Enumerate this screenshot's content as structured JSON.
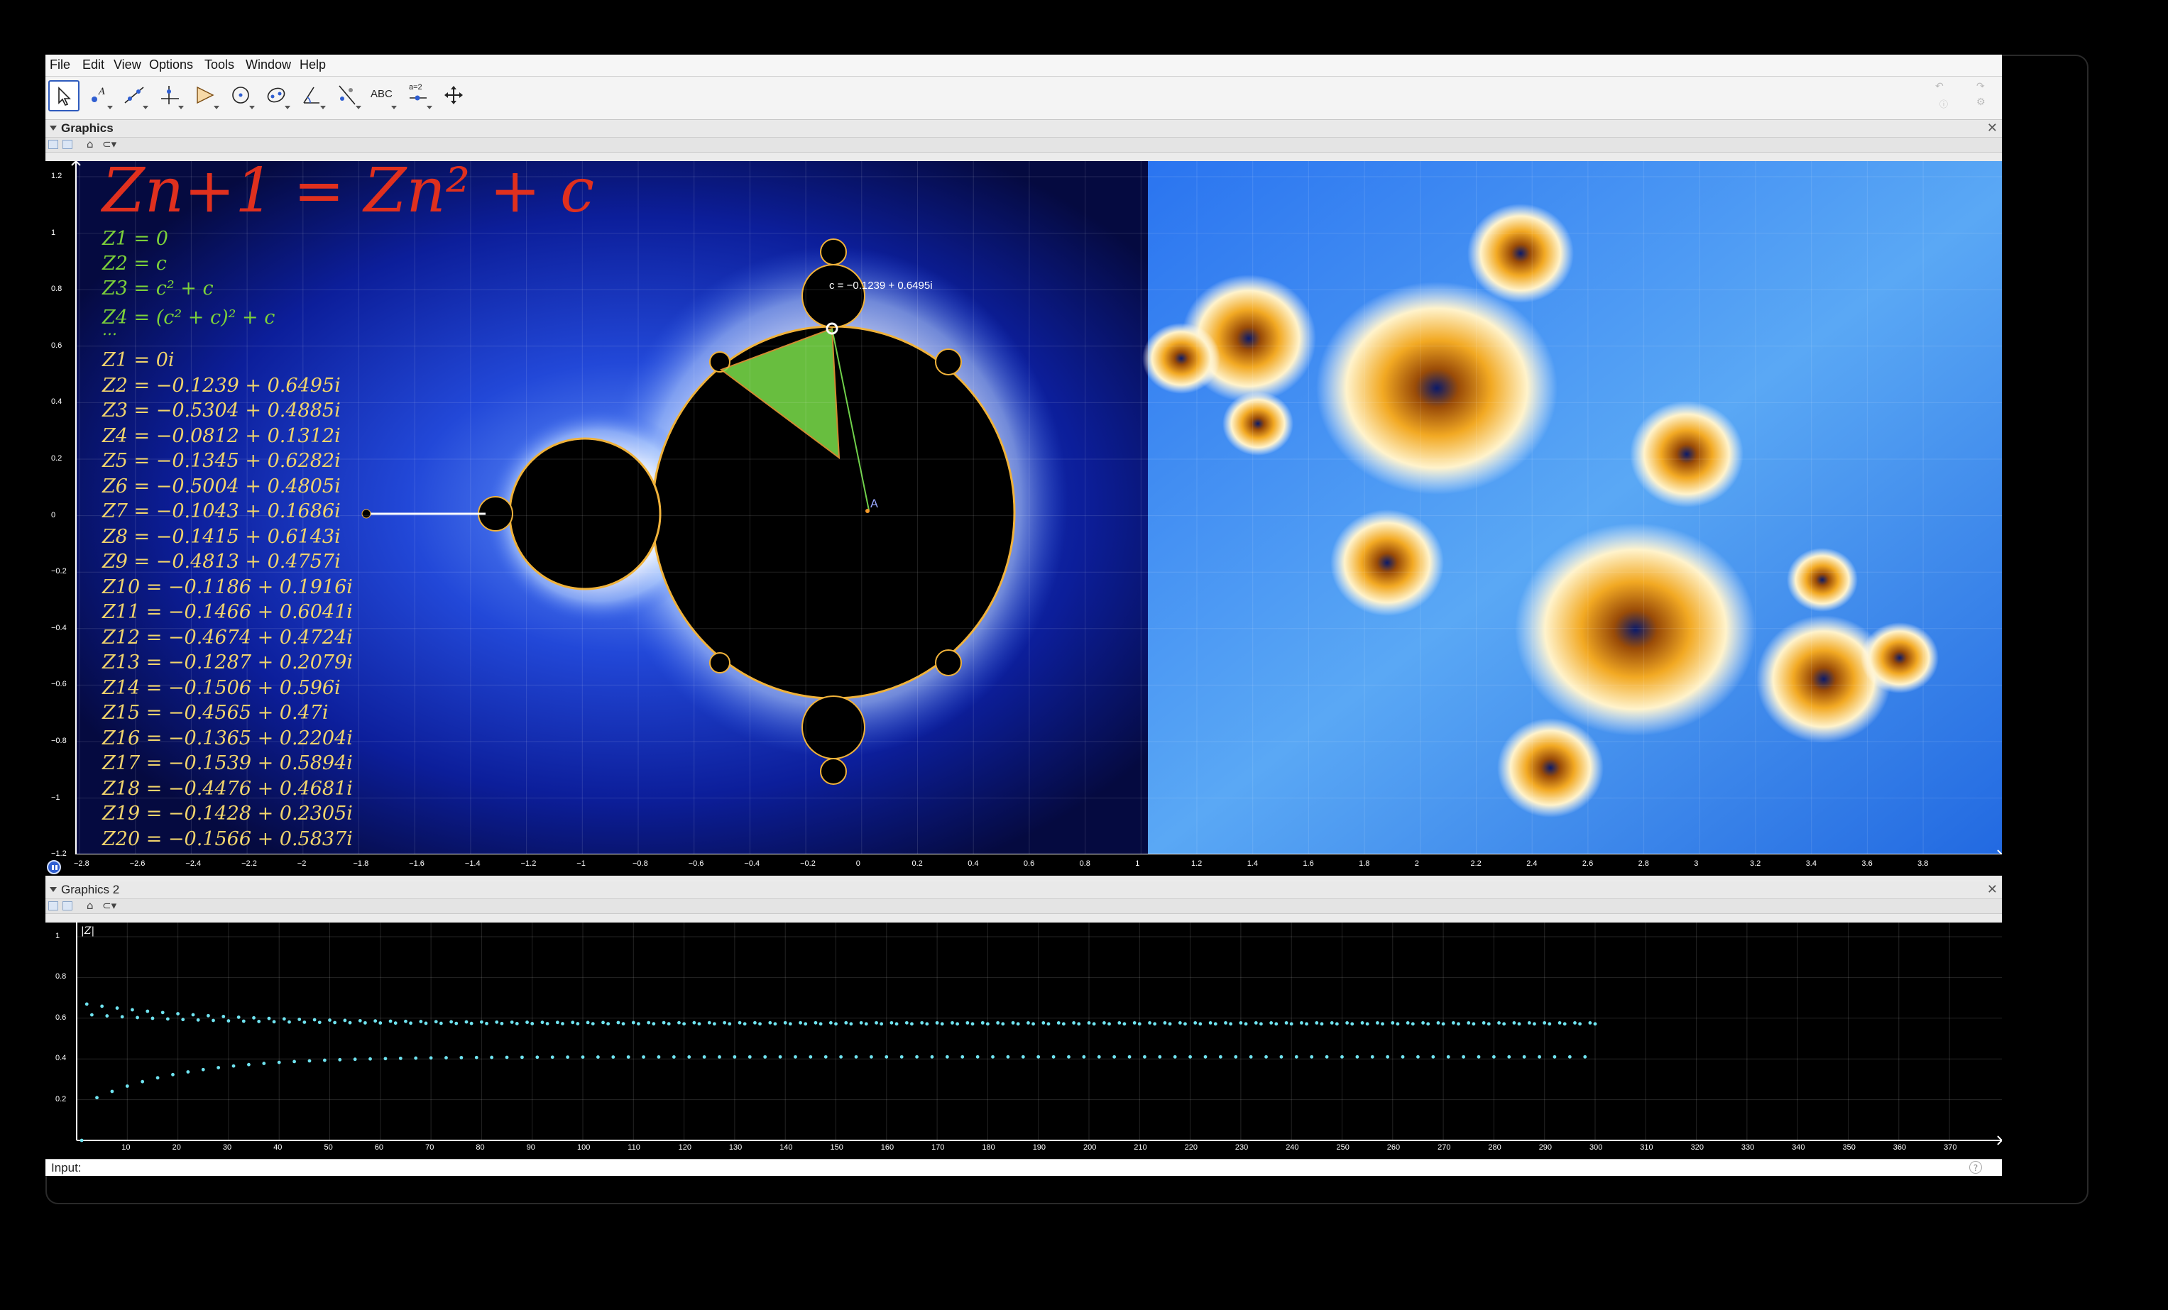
{
  "menu": [
    "File",
    "Edit",
    "View",
    "Options",
    "Tools",
    "Window",
    "Help"
  ],
  "toolbar": {
    "tools": [
      "move-tool",
      "point-tool",
      "line-tool",
      "perpendicular-line-tool",
      "polygon-tool",
      "circle-tool",
      "conic-tool",
      "angle-tool",
      "reflect-tool",
      "text-tool",
      "slider-tool",
      "move-graphics-view-tool"
    ],
    "text_tool_label": "ABC",
    "slider_tool_label": "a=2",
    "undo_icon": "undo-icon",
    "redo_icon": "redo-icon",
    "help_icon": "help-icon",
    "settings_icon": "gear-icon"
  },
  "graphics": {
    "title": "Graphics",
    "formula_main": "Zn+1 = Zn² + c",
    "generic_lines": [
      "Z1 = 0",
      "Z2 = c",
      "Z3 = c² + c",
      "Z4 = (c² + c)² + c",
      "..."
    ],
    "iterates": [
      "Z1 = 0i",
      "Z2 = −0.1239 + 0.6495i",
      "Z3 = −0.5304 + 0.4885i",
      "Z4 = −0.0812 + 0.1312i",
      "Z5 = −0.1345 + 0.6282i",
      "Z6 = −0.5004 + 0.4805i",
      "Z7 = −0.1043 + 0.1686i",
      "Z8 = −0.1415 + 0.6143i",
      "Z9 = −0.4813 + 0.4757i",
      "Z10 = −0.1186 + 0.1916i",
      "Z11 = −0.1466 + 0.6041i",
      "Z12 = −0.4674 + 0.4724i",
      "Z13 = −0.1287 + 0.2079i",
      "Z14 = −0.1506 + 0.596i",
      "Z15 = −0.4565 + 0.47i",
      "Z16 = −0.1365 + 0.2204i",
      "Z17 = −0.1539 + 0.5894i",
      "Z18 = −0.4476 + 0.4681i",
      "Z19 = −0.1428 + 0.2305i",
      "Z20 = −0.1566 + 0.5837i"
    ],
    "point_c_label": "c = −0.1239 + 0.6495i",
    "point_a_label": "A",
    "x_ticks": [
      "−2.8",
      "−2.6",
      "−2.4",
      "−2.2",
      "−2",
      "−1.8",
      "−1.6",
      "−1.4",
      "−1.2",
      "−1",
      "−0.8",
      "−0.6",
      "−0.4",
      "−0.2",
      "0",
      "0.2",
      "0.4",
      "0.6",
      "0.8",
      "1",
      "1.2",
      "1.4",
      "1.6",
      "1.8",
      "2",
      "2.2",
      "2.4",
      "2.6",
      "2.8",
      "3",
      "3.2",
      "3.4",
      "3.6",
      "3.8"
    ],
    "y_ticks": [
      "1.2",
      "1",
      "0.8",
      "0.6",
      "0.4",
      "0.2",
      "0",
      "−0.2",
      "−0.4",
      "−0.6",
      "−0.8",
      "−1",
      "−1.2"
    ],
    "colors": {
      "formula": "#e0301e",
      "generic": "#7cd13a",
      "iterates": "#f1d46c",
      "mandel_bg": "#0b1a8a",
      "julia_bg": "#2a7ae8"
    }
  },
  "graphics2": {
    "title": "Graphics 2",
    "y_axis_label": "|Z|",
    "x_ticks": [
      "10",
      "20",
      "30",
      "40",
      "50",
      "60",
      "70",
      "80",
      "90",
      "100",
      "110",
      "120",
      "130",
      "140",
      "150",
      "160",
      "170",
      "180",
      "190",
      "200",
      "210",
      "220",
      "230",
      "240",
      "250",
      "260",
      "270",
      "280",
      "290",
      "300",
      "310",
      "320",
      "330",
      "340",
      "350",
      "360",
      "370"
    ],
    "y_ticks": [
      "1",
      "0.8",
      "0.6",
      "0.4",
      "0.2"
    ],
    "point_color": "#6fe3f0"
  },
  "input": {
    "label": "Input:"
  }
}
